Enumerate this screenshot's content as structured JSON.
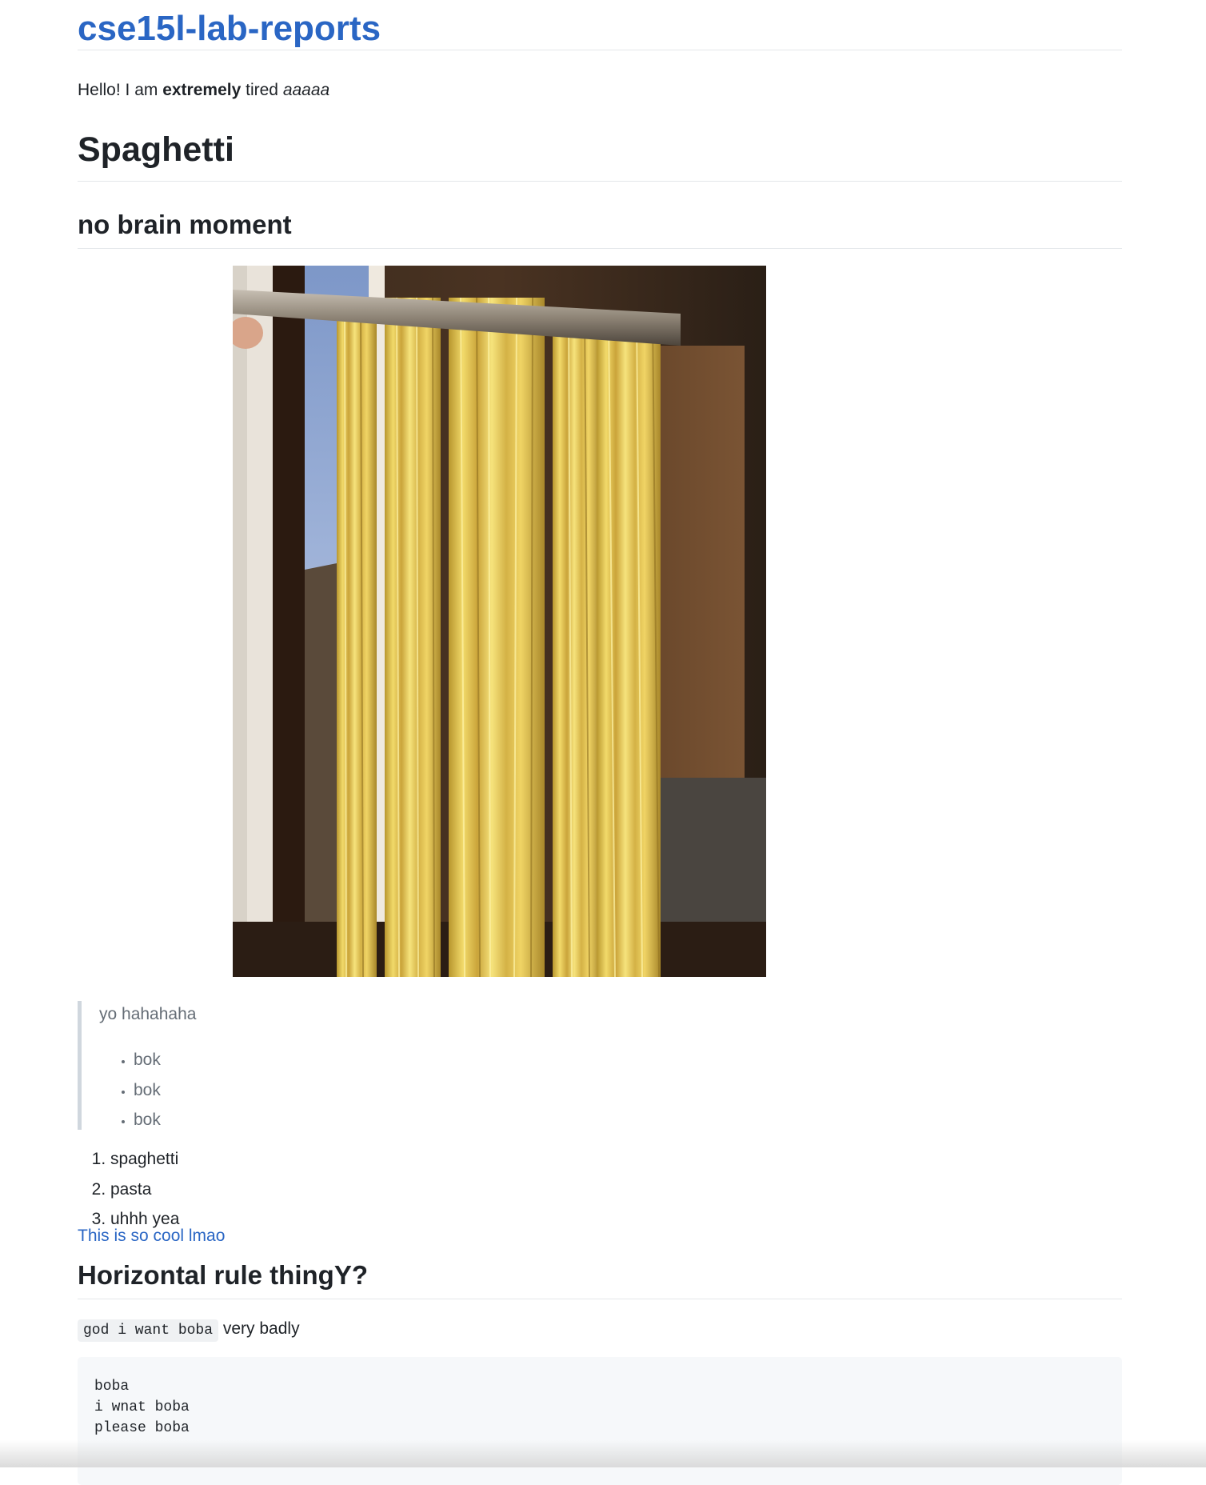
{
  "site": {
    "title": "cse15l-lab-reports"
  },
  "intro": {
    "before": "Hello! I am ",
    "bold": "extremely",
    "middle": " tired ",
    "italic": "aaaaa"
  },
  "sections": {
    "spaghetti_heading": "Spaghetti",
    "brain_heading": "no brain moment",
    "rule_heading": "Horizontal rule thingY?"
  },
  "image_line": {
    "link_text": "This is so cool lmao",
    "image_alt": "spaghetti drying on a rod by a window"
  },
  "blockquote": {
    "text": "yo hahahaha",
    "items": [
      "bok",
      "bok",
      "bok"
    ]
  },
  "ordered_list": [
    "spaghetti",
    "pasta",
    "uhhh yea"
  ],
  "inline": {
    "code": "god i want boba",
    "after": " very badly"
  },
  "code_block": {
    "lines": [
      "boba",
      "i wnat boba",
      "please boba"
    ]
  },
  "colors": {
    "link": "#2a66c4",
    "text": "#1f2328",
    "muted": "#656d76",
    "border": "#e4e7ea",
    "code_bg": "#f6f8fa"
  }
}
